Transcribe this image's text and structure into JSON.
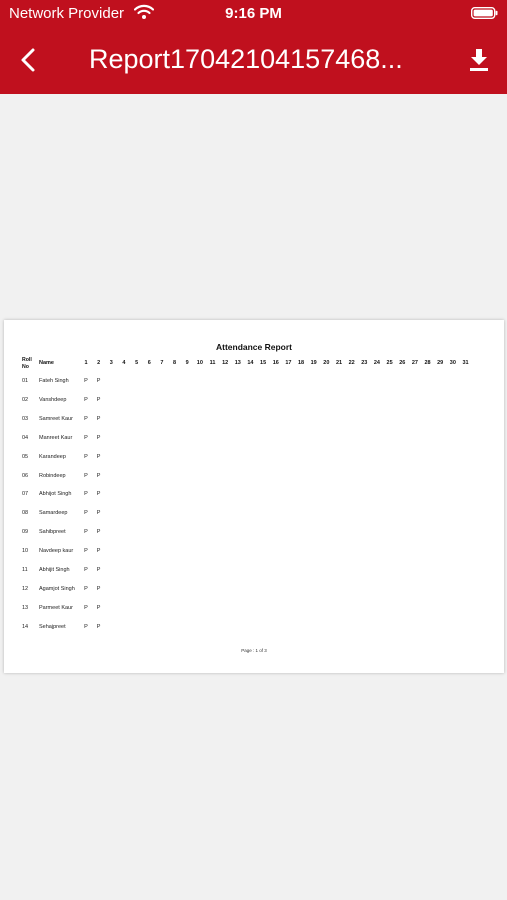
{
  "status_bar": {
    "carrier": "Network Provider",
    "time": "9:16 PM",
    "wifi_icon": "wifi-icon",
    "battery_icon": "battery-icon"
  },
  "nav": {
    "title": "Report17042104157468...",
    "back_icon": "chevron-left-icon",
    "download_icon": "download-icon"
  },
  "report": {
    "title": "Attendance Report",
    "col_roll": "Roll No",
    "col_name": "Name",
    "days": [
      "1",
      "2",
      "3",
      "4",
      "5",
      "6",
      "7",
      "8",
      "9",
      "10",
      "11",
      "12",
      "13",
      "14",
      "15",
      "16",
      "17",
      "18",
      "19",
      "20",
      "21",
      "22",
      "23",
      "24",
      "25",
      "26",
      "27",
      "28",
      "29",
      "30",
      "31"
    ],
    "rows": [
      {
        "roll": "01",
        "name": "Fateh Singh",
        "att": [
          "P",
          "P"
        ]
      },
      {
        "roll": "02",
        "name": "Vanshdeep",
        "att": [
          "P",
          "P"
        ]
      },
      {
        "roll": "03",
        "name": "Samreet Kaur",
        "att": [
          "P",
          "P"
        ]
      },
      {
        "roll": "04",
        "name": "Manreet Kaur",
        "att": [
          "P",
          "P"
        ]
      },
      {
        "roll": "05",
        "name": "Karandeep",
        "att": [
          "P",
          "P"
        ]
      },
      {
        "roll": "06",
        "name": "Robindeep",
        "att": [
          "P",
          "P"
        ]
      },
      {
        "roll": "07",
        "name": "Abhijot Singh",
        "att": [
          "P",
          "P"
        ]
      },
      {
        "roll": "08",
        "name": "Samardeep",
        "att": [
          "P",
          "P"
        ]
      },
      {
        "roll": "09",
        "name": "Sahibpreet",
        "att": [
          "P",
          "P"
        ]
      },
      {
        "roll": "10",
        "name": "Navdeep kaur",
        "att": [
          "P",
          "P"
        ]
      },
      {
        "roll": "11",
        "name": "Abhijit Singh",
        "att": [
          "P",
          "P"
        ]
      },
      {
        "roll": "12",
        "name": "Agamjot Singh",
        "att": [
          "P",
          "P"
        ]
      },
      {
        "roll": "13",
        "name": "Parmeet Kaur",
        "att": [
          "P",
          "P"
        ]
      },
      {
        "roll": "14",
        "name": "Sehajpreet",
        "att": [
          "P",
          "P"
        ]
      }
    ],
    "footer": "Page : 1 of 3"
  },
  "colors": {
    "header_bg": "#c0101e",
    "screen_bg": "#f1f1f1"
  }
}
